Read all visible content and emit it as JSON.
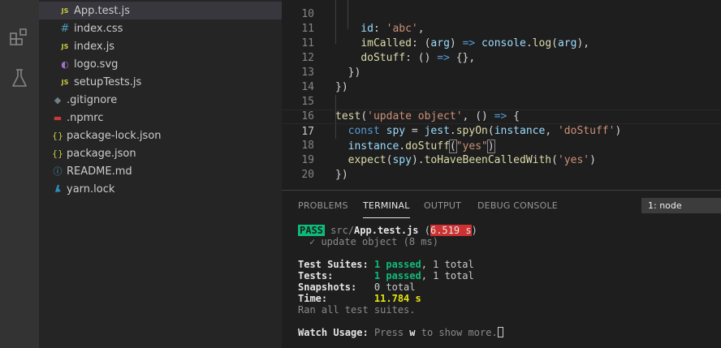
{
  "explorer": {
    "items": [
      {
        "label": "App.test.js",
        "icon": "js-file-icon",
        "glyph": "JS",
        "selected": true
      },
      {
        "label": "index.css",
        "icon": "css-file-icon",
        "glyph": "#"
      },
      {
        "label": "index.js",
        "icon": "js-file-icon",
        "glyph": "JS"
      },
      {
        "label": "logo.svg",
        "icon": "svg-file-icon",
        "glyph": "◐"
      },
      {
        "label": "setupTests.js",
        "icon": "js-file-icon",
        "glyph": "JS"
      },
      {
        "label": ".gitignore",
        "icon": "git-file-icon",
        "glyph": "◆"
      },
      {
        "label": ".npmrc",
        "icon": "npm-file-icon",
        "glyph": "▬"
      },
      {
        "label": "package-lock.json",
        "icon": "json-file-icon",
        "glyph": "{}"
      },
      {
        "label": "package.json",
        "icon": "json-file-icon",
        "glyph": "{}"
      },
      {
        "label": "README.md",
        "icon": "info-file-icon",
        "glyph": "ⓘ"
      },
      {
        "label": "yarn.lock",
        "icon": "yarn-file-icon",
        "glyph": "🐈"
      }
    ]
  },
  "editor": {
    "current_line": "17",
    "lines": [
      {
        "n": "10",
        "text": "    id: 'abc',"
      },
      {
        "n": "11",
        "text": "    imCalled: (arg) => console.log(arg),"
      },
      {
        "n": "11",
        "text": "    doStuff: () => {},"
      },
      {
        "n": "12",
        "text": "  })"
      },
      {
        "n": "13",
        "text": "})"
      },
      {
        "n": "14",
        "text": ""
      },
      {
        "n": "15",
        "text": "test('update object', () => {"
      },
      {
        "n": "16",
        "text": "  const spy = jest.spyOn(instance, 'doStuff')"
      },
      {
        "n": "17",
        "text": "  instance.doStuff(\"yes\")"
      },
      {
        "n": "18",
        "text": "  expect(spy).toHaveBeenCalledWith('yes')"
      },
      {
        "n": "19",
        "text": "})"
      },
      {
        "n": "20",
        "text": ""
      }
    ]
  },
  "panel": {
    "tabs": [
      "PROBLEMS",
      "TERMINAL",
      "OUTPUT",
      "DEBUG CONSOLE"
    ],
    "active_tab": "TERMINAL",
    "terminal_select": "1: node"
  },
  "terminal": {
    "pass": "PASS",
    "file_dir": "src/",
    "file_name": "App.test.js",
    "duration": "6.519 s",
    "test_name": "✓ update object (8 ms)",
    "suites_label": "Test Suites:",
    "suites_passed": "1 passed",
    "suites_total": ", 1 total",
    "tests_label": "Tests:",
    "tests_passed": "1 passed",
    "tests_total": ", 1 total",
    "snapshots_label": "Snapshots:",
    "snapshots_value": "0 total",
    "time_label": "Time:",
    "time_value": "11.784 s",
    "ran_all": "Ran all test suites.",
    "watch_label": "Watch Usage:",
    "watch_press": "Press ",
    "watch_key": "w",
    "watch_rest": " to show more."
  },
  "colors": {
    "pass": "#0dbc79",
    "slow": "#cd3131",
    "time": "#e5e510"
  }
}
